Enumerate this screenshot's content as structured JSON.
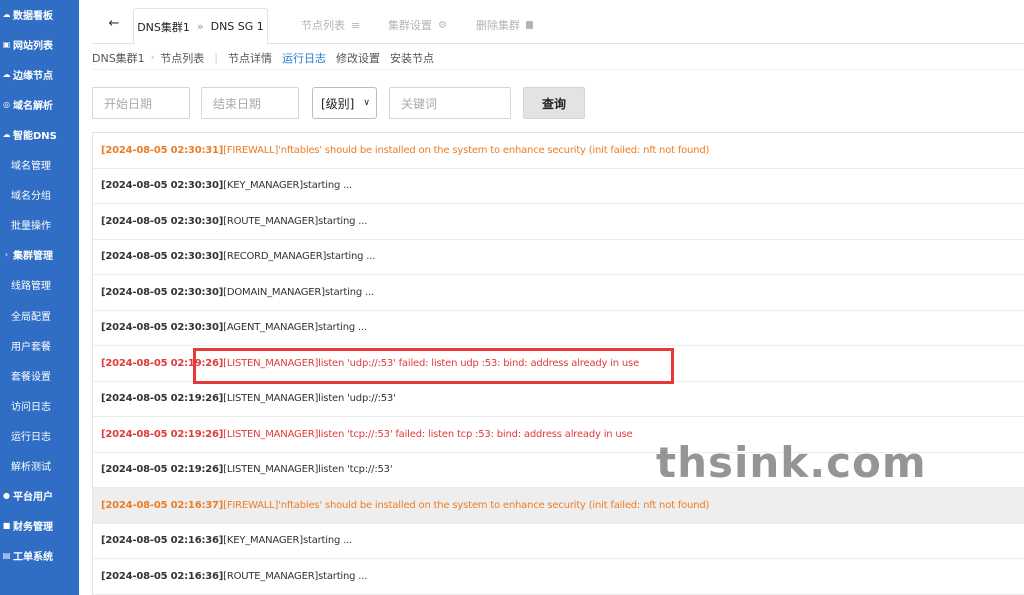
{
  "sidebar": {
    "items": [
      {
        "label": "数据看板",
        "icon": "cloud-icon",
        "level": "top"
      },
      {
        "label": "网站列表",
        "icon": "window-icon",
        "level": "top"
      },
      {
        "label": "边缘节点",
        "icon": "cloud-icon",
        "level": "top"
      },
      {
        "label": "域名解析",
        "icon": "globe-icon",
        "level": "top"
      },
      {
        "label": "智能DNS",
        "icon": "cloud-icon",
        "level": "top"
      },
      {
        "label": "域名管理",
        "icon": "",
        "level": "sub"
      },
      {
        "label": "域名分组",
        "icon": "",
        "level": "sub"
      },
      {
        "label": "批量操作",
        "icon": "",
        "level": "sub"
      },
      {
        "label": "集群管理",
        "icon": "chevron-right-icon",
        "level": "top"
      },
      {
        "label": "线路管理",
        "icon": "",
        "level": "sub"
      },
      {
        "label": "全局配置",
        "icon": "",
        "level": "sub"
      },
      {
        "label": "用户套餐",
        "icon": "",
        "level": "sub"
      },
      {
        "label": "套餐设置",
        "icon": "",
        "level": "sub"
      },
      {
        "label": "访问日志",
        "icon": "",
        "level": "sub"
      },
      {
        "label": "运行日志",
        "icon": "",
        "level": "sub"
      },
      {
        "label": "解析测试",
        "icon": "",
        "level": "sub"
      },
      {
        "label": "平台用户",
        "icon": "user-icon",
        "level": "top"
      },
      {
        "label": "财务管理",
        "icon": "money-icon",
        "level": "top"
      },
      {
        "label": "工单系统",
        "icon": "ticket-icon",
        "level": "top"
      }
    ]
  },
  "tabs": {
    "back_icon": "arrow-left-icon",
    "active_part1": "DNS集群1",
    "active_separator": "»",
    "active_part2": "DNS SG 1",
    "node_list": "节点列表",
    "cluster_settings": "集群设置",
    "delete_cluster": "删除集群"
  },
  "breadcrumb": {
    "cluster": "DNS集群1",
    "node_list": "节点列表",
    "links": [
      {
        "label": "节点详情",
        "active": false
      },
      {
        "label": "运行日志",
        "active": true
      },
      {
        "label": "修改设置",
        "active": false
      },
      {
        "label": "安装节点",
        "active": false
      }
    ]
  },
  "filters": {
    "start_date_placeholder": "开始日期",
    "end_date_placeholder": "结束日期",
    "level_value": "[级别]",
    "keyword_placeholder": "关键词",
    "query_button": "查询"
  },
  "logs": [
    {
      "time": "[2024-08-05 02:30:31]",
      "message": "[FIREWALL]'nftables' should be installed on the system to enhance security (init failed: nft not found)",
      "level": "warn"
    },
    {
      "time": "[2024-08-05 02:30:30]",
      "message": "[KEY_MANAGER]starting ...",
      "level": "info"
    },
    {
      "time": "[2024-08-05 02:30:30]",
      "message": "[ROUTE_MANAGER]starting ...",
      "level": "info"
    },
    {
      "time": "[2024-08-05 02:30:30]",
      "message": "[RECORD_MANAGER]starting ...",
      "level": "info"
    },
    {
      "time": "[2024-08-05 02:30:30]",
      "message": "[DOMAIN_MANAGER]starting ...",
      "level": "info"
    },
    {
      "time": "[2024-08-05 02:30:30]",
      "message": "[AGENT_MANAGER]starting ...",
      "level": "info"
    },
    {
      "time": "[2024-08-05 02:19:26]",
      "message": "[LISTEN_MANAGER]listen 'udp://:53' failed: listen udp :53: bind: address already in use",
      "level": "error"
    },
    {
      "time": "[2024-08-05 02:19:26]",
      "message": "[LISTEN_MANAGER]listen 'udp://:53'",
      "level": "info"
    },
    {
      "time": "[2024-08-05 02:19:26]",
      "message": "[LISTEN_MANAGER]listen 'tcp://:53' failed: listen tcp :53: bind: address already in use",
      "level": "error"
    },
    {
      "time": "[2024-08-05 02:19:26]",
      "message": "[LISTEN_MANAGER]listen 'tcp://:53'",
      "level": "info"
    },
    {
      "time": "[2024-08-05 02:16:37]",
      "message": "[FIREWALL]'nftables' should be installed on the system to enhance security (init failed: nft not found)",
      "level": "warn",
      "shaded": true
    },
    {
      "time": "[2024-08-05 02:16:36]",
      "message": "[KEY_MANAGER]starting ...",
      "level": "info"
    },
    {
      "time": "[2024-08-05 02:16:36]",
      "message": "[ROUTE_MANAGER]starting ...",
      "level": "info"
    }
  ],
  "watermark": "thsink.com",
  "colors": {
    "sidebar_bg": "#2f6ec4",
    "link_active": "#2b78d1",
    "warn": "#ec7d25",
    "error": "#e03a3a",
    "highlight_box": "#e53a3a"
  }
}
